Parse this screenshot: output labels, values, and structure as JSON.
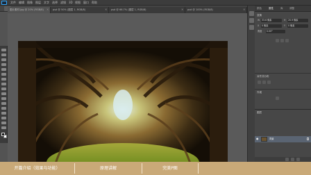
{
  "menubar": {
    "items": [
      "文件",
      "编辑",
      "图像",
      "图层",
      "文字",
      "选择",
      "滤镜",
      "3D",
      "视图",
      "窗口",
      "帮助"
    ]
  },
  "tabs": [
    {
      "label": "图片素材.jpg @ 20% (RGB/8)"
    },
    {
      "label": "psd @ 50% (图层 1, RGB/8)"
    },
    {
      "label": "psd @ 66.7% (图层 1, RGB/8)"
    },
    {
      "label": "psd @ 100% (RGB/8)"
    }
  ],
  "panel": {
    "tabs": [
      "颜色",
      "属性",
      "库",
      "调整"
    ],
    "active_tab": "属性",
    "section_transform": "变换",
    "w_label": "W",
    "w_value": "33.6 像素",
    "h_label": "H",
    "h_value": "20.9 像素",
    "x_label": "X",
    "x_value": "0 像素",
    "y_label": "Y",
    "y_value": "0 像素",
    "angle_label": "角度",
    "angle_value": "0.00°",
    "section_align": "对齐并分布",
    "section_appearance": "外观"
  },
  "layers": {
    "title": "图层",
    "layer_name": "背景"
  },
  "bottom": {
    "buttons": [
      "开篇介绍（效果与功能）",
      "原理讲解",
      "完美P图"
    ]
  },
  "colors": {
    "accent": "#31a8ff",
    "bottom_bar": "#c9a978"
  }
}
